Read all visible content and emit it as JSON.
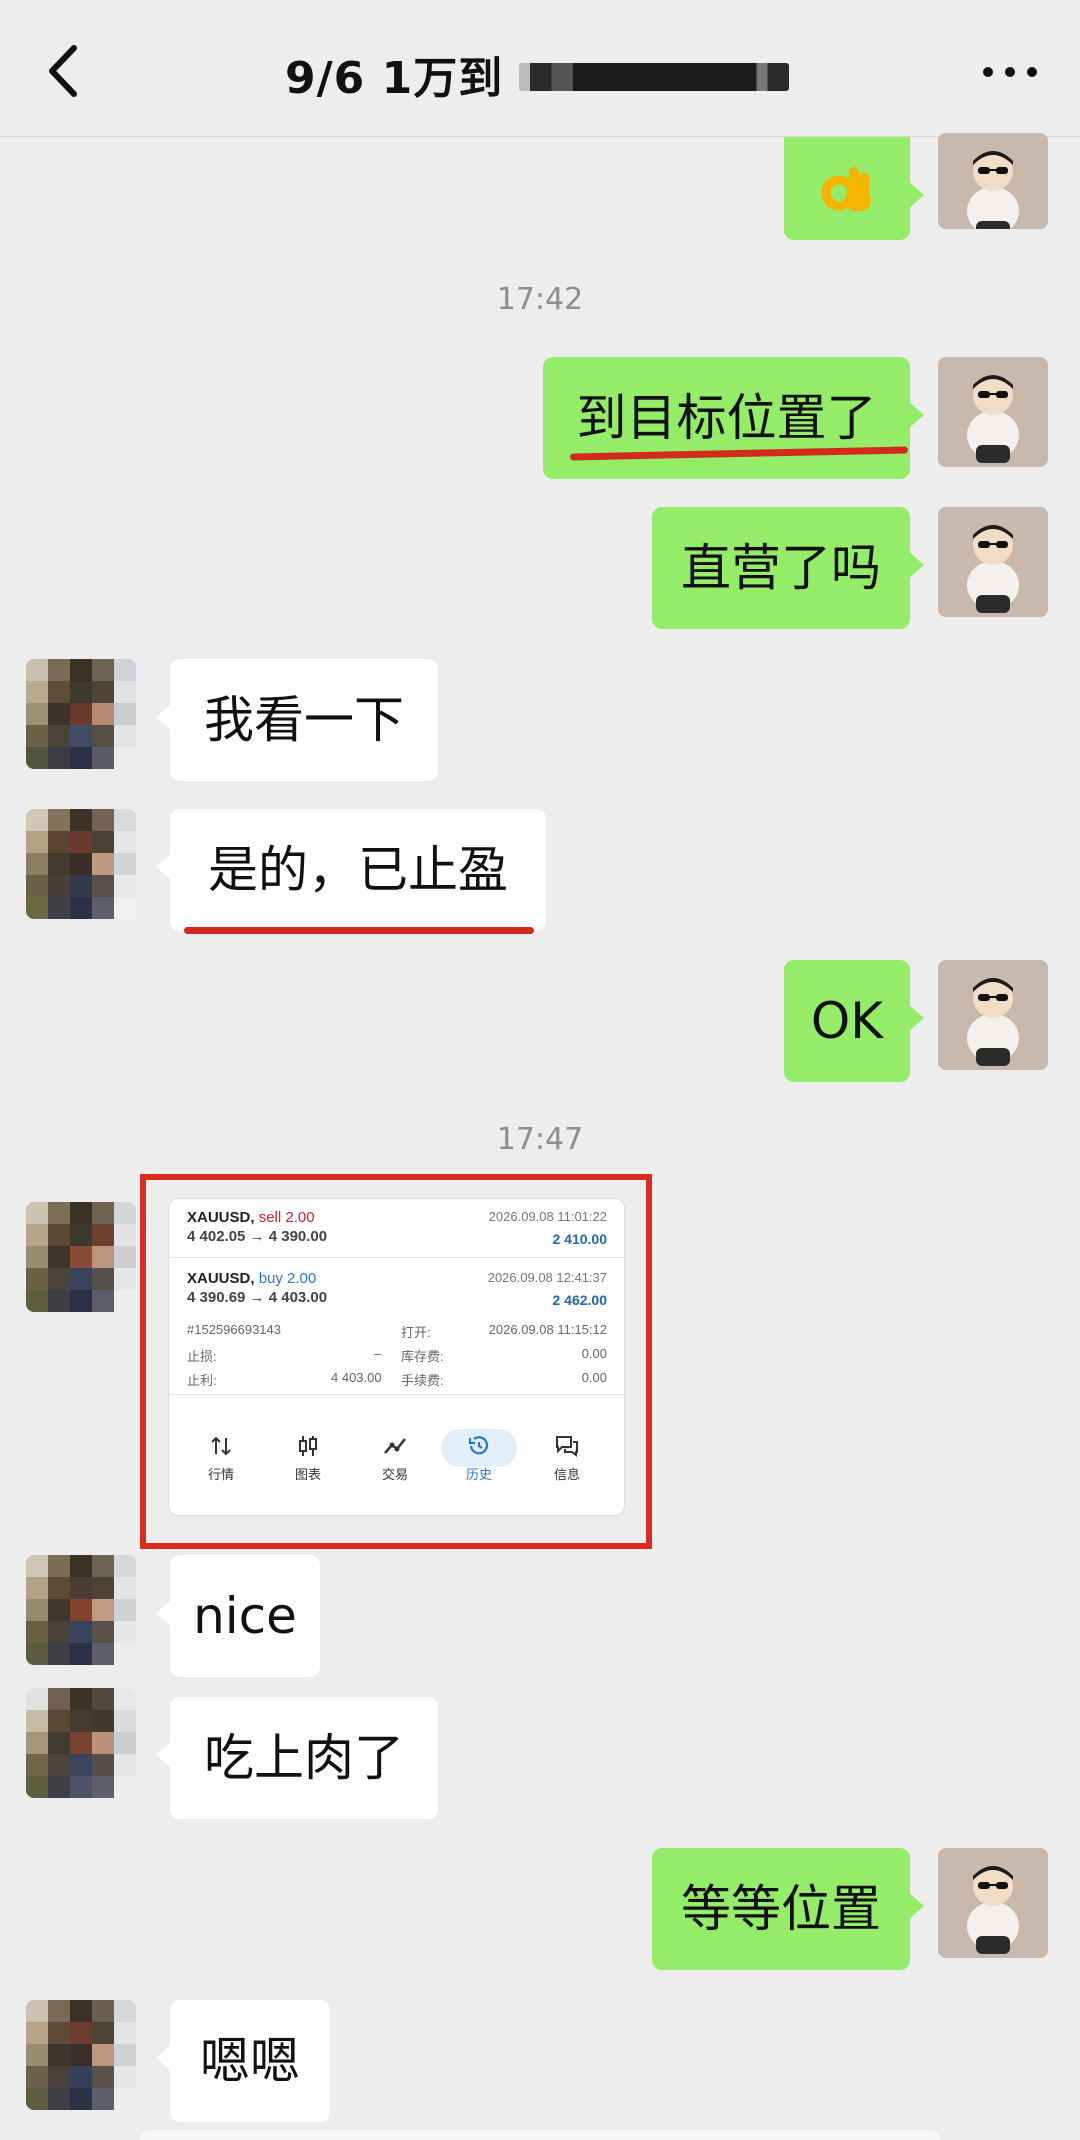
{
  "header": {
    "title": "9/6  1万到",
    "back_icon": "chevron-left-icon",
    "more_icon": "more-dots-icon"
  },
  "colors": {
    "my_bubble": "#95ec69",
    "other_bubble": "#ffffff",
    "background": "#ededed",
    "highlight": "#d42a1c"
  },
  "timestamps": [
    "17:42",
    "17:47"
  ],
  "messages": [
    {
      "from": "me",
      "text": "👌"
    },
    {
      "from": "me",
      "text": "到目标位置了"
    },
    {
      "from": "me",
      "text": "直营了吗"
    },
    {
      "from": "other",
      "text": "我看一下"
    },
    {
      "from": "other",
      "text": "是的，已止盈"
    },
    {
      "from": "me",
      "text": "OK"
    },
    {
      "from": "other",
      "text": "nice"
    },
    {
      "from": "other",
      "text": "吃上肉了"
    },
    {
      "from": "me",
      "text": "等等位置"
    },
    {
      "from": "other",
      "text": "嗯嗯"
    }
  ],
  "trade_screenshot": {
    "trades": [
      {
        "symbol": "XAUUSD,",
        "side": "sell 2.00",
        "prices": "4 402.05 → 4 390.00",
        "date": "2026.09.08 11:01:22",
        "profit": "2 410.00"
      },
      {
        "symbol": "XAUUSD,",
        "side": "buy 2.00",
        "prices": "4 390.69 → 4 403.00",
        "date": "2026.09.08 12:41:37",
        "profit": "2 462.00"
      }
    ],
    "details": {
      "order_id": "#152596693143",
      "open_label": "打开:",
      "open_value": "2026.09.08 11:15:12",
      "sl_label": "止损:",
      "sl_value": "–",
      "swap_label": "库存费:",
      "swap_value": "0.00",
      "tp_label": "止利:",
      "tp_value": "4 403.00",
      "fee_label": "手续费:",
      "fee_value": "0.00"
    },
    "nav": [
      {
        "label": "行情",
        "icon": "sort-arrows-icon",
        "active": false
      },
      {
        "label": "图表",
        "icon": "candlestick-icon",
        "active": false
      },
      {
        "label": "交易",
        "icon": "trend-line-icon",
        "active": false
      },
      {
        "label": "历史",
        "icon": "history-clock-icon",
        "active": true
      },
      {
        "label": "信息",
        "icon": "chat-bubbles-icon",
        "active": false
      }
    ]
  }
}
